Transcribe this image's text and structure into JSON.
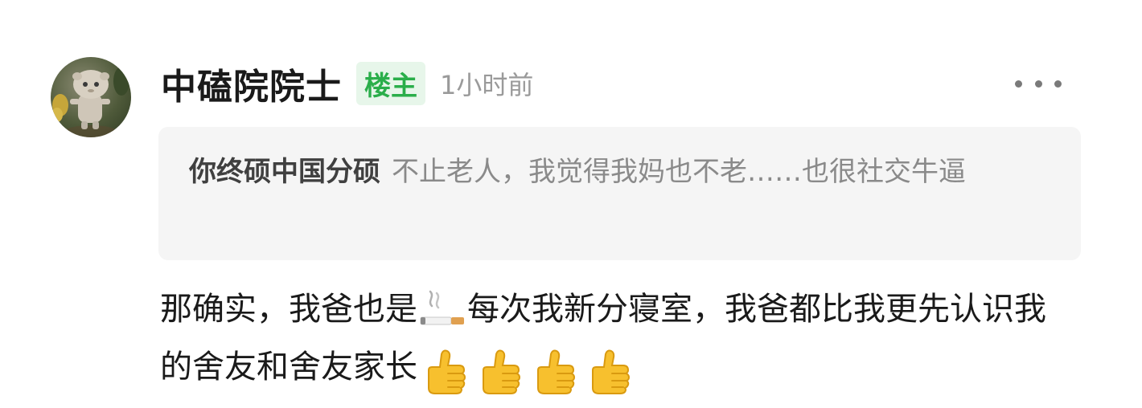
{
  "comment": {
    "author": "中磕院院士",
    "op_badge": "楼主",
    "timestamp": "1小时前",
    "more_icon": "more-dots-icon",
    "quote": {
      "author": "你终硕中国分硕",
      "text": "不止老人，我觉得我妈也不老……也很社交牛逼"
    },
    "reply": {
      "part1": "那确实，我爸也是",
      "emoji_1": "cigarette-emoji",
      "part2": "每次我新分寝室，我爸都比我更先认识我的舍友和舍友家长",
      "trailing_emoji": [
        "thumbs-up-emoji",
        "thumbs-up-emoji",
        "thumbs-up-emoji",
        "thumbs-up-emoji"
      ]
    },
    "colors": {
      "badge_bg": "#e7f6ea",
      "badge_text": "#2aae4a",
      "quote_bg": "#f5f5f5"
    }
  }
}
